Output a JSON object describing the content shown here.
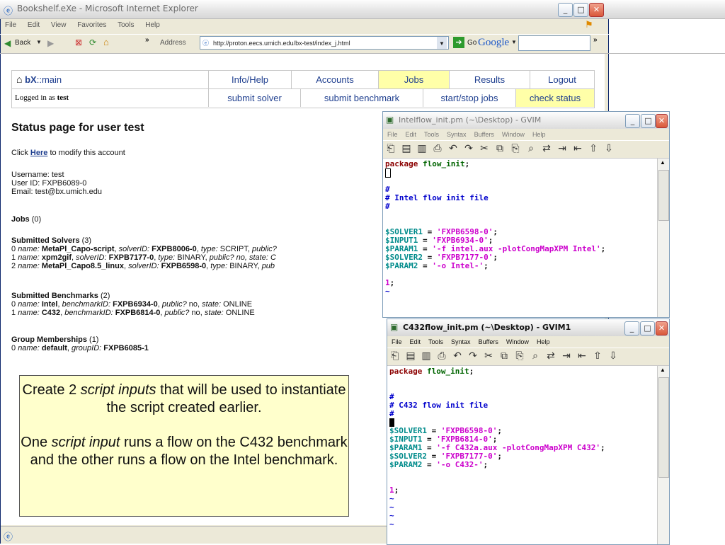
{
  "ie": {
    "title": "Bookshelf.eXe - Microsoft Internet Explorer",
    "menu": [
      "File",
      "Edit",
      "View",
      "Favorites",
      "Tools",
      "Help"
    ],
    "toolbar": {
      "back_label": "Back",
      "more": "»",
      "address_label": "Address",
      "address_value": "http://proton.eecs.umich.edu/bx-test/index_j.html",
      "go_label": "Go",
      "google_label": "Google"
    }
  },
  "page": {
    "logo": "bX",
    "logo_suffix": "::main",
    "nav_top": [
      "Info/Help",
      "Accounts",
      "Jobs",
      "Results",
      "Logout"
    ],
    "logged_in_prefix": "Logged in as",
    "logged_in_user": "test",
    "nav_sub": [
      "submit solver",
      "submit benchmark",
      "start/stop jobs",
      "check status"
    ],
    "heading": "Status page for user test",
    "modify_prefix": "Click",
    "modify_link": "Here",
    "modify_suffix": "to modify this account",
    "username": "Username: test",
    "userid": "User ID: FXPB6089-0",
    "email": "Email: test@bx.umich.edu",
    "jobs_label": "Jobs",
    "jobs_count": "(0)",
    "solvers_label": "Submitted Solvers",
    "solvers_count": "(3)",
    "solvers": [
      {
        "idx": "0",
        "name": "MetaPl_Capo-script",
        "id": "FXPB8006-0",
        "type": "SCRIPT",
        "tail": "public?"
      },
      {
        "idx": "1",
        "name": "xpm2gif",
        "id": "FXPB7177-0",
        "type": "BINARY",
        "tail": "public? no, state: C"
      },
      {
        "idx": "2",
        "name": "MetaPl_Capo8.5_linux",
        "id": "FXPB6598-0",
        "type": "BINARY",
        "tail": "pub"
      }
    ],
    "benchmarks_label": "Submitted Benchmarks",
    "benchmarks_count": "(2)",
    "benchmarks": [
      {
        "idx": "0",
        "name": "Intel",
        "id": "FXPB6934-0",
        "public": "no",
        "state": "ONLINE"
      },
      {
        "idx": "1",
        "name": "C432",
        "id": "FXPB6814-0",
        "public": "no",
        "state": "ONLINE"
      }
    ],
    "groups_label": "Group Memberships",
    "groups_count": "(1)",
    "group": {
      "idx": "0",
      "name": "default",
      "id": "FXPB6085-1"
    }
  },
  "gvim1": {
    "title": "Intelflow_init.pm (~\\Desktop) - GVIM",
    "menu": [
      "File",
      "Edit",
      "Tools",
      "Syntax",
      "Buffers",
      "Window",
      "Help"
    ],
    "lines": {
      "pkg_kw": "package",
      "pkg_name": "flow_init",
      "semi": ";",
      "hash": "#",
      "comment": "# Intel flow init file",
      "v1": "$SOLVER1",
      "s1": "'FXPB6598-0'",
      "v2": "$INPUT1",
      "s2": "'FXPB6934-0'",
      "v3": "$PARAM1",
      "s3": "'-f intel.aux -plotCongMapXPM Intel'",
      "v4": "$SOLVER2",
      "s4": "'FXPB7177-0'",
      "v5": "$PARAM2",
      "s5": "'-o Intel-'",
      "one": "1",
      "eq": " = ",
      "tilde": "~"
    }
  },
  "gvim2": {
    "title": "C432flow_init.pm (~\\Desktop) - GVIM1",
    "menu": [
      "File",
      "Edit",
      "Tools",
      "Syntax",
      "Buffers",
      "Window",
      "Help"
    ],
    "lines": {
      "pkg_kw": "package",
      "pkg_name": "flow_init",
      "semi": ";",
      "hash": "#",
      "comment": "# C432 flow init file",
      "v1": "$SOLVER1",
      "s1": "'FXPB6598-0'",
      "v2": "$INPUT1",
      "s2": "'FXPB6814-0'",
      "v3": "$PARAM1",
      "s3": "'-f C432a.aux -plotCongMapXPM C432'",
      "v4": "$SOLVER2",
      "s4": "'FXPB7177-0'",
      "v5": "$PARAM2",
      "s5": "'-o C432-'",
      "one": "1",
      "eq": " = ",
      "tilde": "~"
    }
  },
  "callout": {
    "p1_a": "Create 2",
    "p1_em": "script inputs",
    "p1_b": "that will be used to instantiate the script created earlier.",
    "p2_a": "One",
    "p2_em": "script input",
    "p2_b": "runs a flow on the C432 benchmark and the other runs a flow on the Intel benchmark."
  },
  "colors": {
    "highlight": "#ffffa8",
    "link": "#1f3f8f",
    "callout_bg": "#ffffcc"
  }
}
